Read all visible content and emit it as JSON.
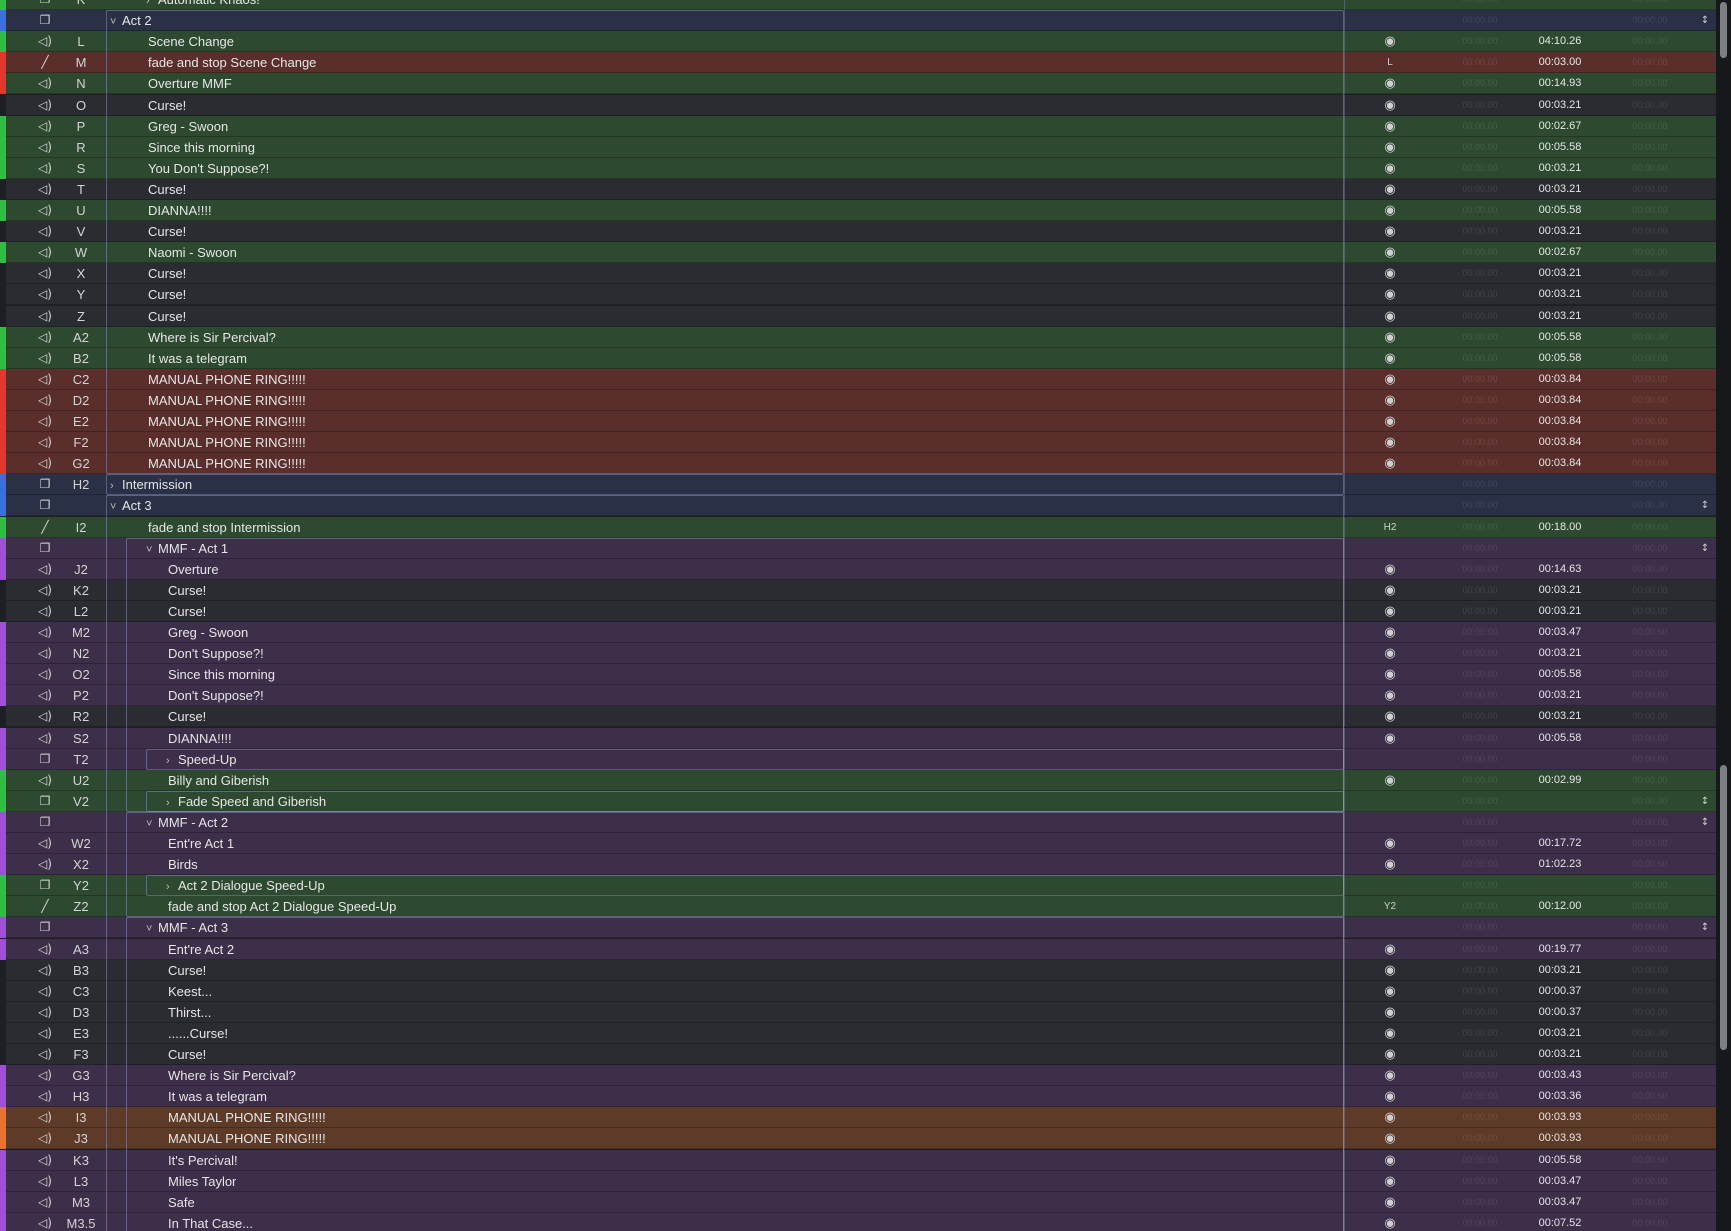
{
  "colors": {
    "dark": "#2b2c31",
    "green": "#2d4a30",
    "red": "#5a2f2b",
    "purple": "#3d2e4a",
    "orange": "#5e3a28",
    "navy": "#2a3046",
    "navy_green": "#2f3e3a",
    "bar_green": "#2fbf45",
    "bar_red": "#e0382c",
    "bar_purple": "#a04fd8",
    "bar_blue": "#3a6fe0",
    "bar_orange": "#e8732a",
    "bar_none": "#1e1f24"
  },
  "icons": {
    "audio": "speaker-icon",
    "group": "group-icon",
    "fade": "fade-icon",
    "target": "target-icon",
    "expanded": "chevron-down-icon",
    "collapsed": "chevron-right-icon",
    "continue": "auto-continue-icon"
  },
  "cues": [
    {
      "type": "group",
      "num": "K",
      "name": "Automatic Knaos!",
      "level": 1,
      "chev": "collapsed",
      "bg": "green",
      "bar": "green",
      "target": "",
      "duration": "",
      "cont": ""
    },
    {
      "type": "group",
      "num": "",
      "name": "Act 2",
      "level": 0,
      "chev": "expanded",
      "bg": "navy",
      "bar": "blue",
      "target": "",
      "duration": "",
      "cont": "continue"
    },
    {
      "type": "audio",
      "num": "L",
      "name": "Scene Change",
      "level": 1,
      "bg": "green",
      "bar": "green",
      "target": "icon",
      "duration": "04:10.26",
      "cont": ""
    },
    {
      "type": "fade",
      "num": "M",
      "name": "fade and stop Scene Change",
      "level": 1,
      "bg": "red",
      "bar": "red",
      "target": "L",
      "duration": "00:03.00",
      "cont": ""
    },
    {
      "type": "audio",
      "num": "N",
      "name": "Overture MMF",
      "level": 1,
      "bg": "green",
      "bar": "red",
      "target": "icon",
      "duration": "00:14.93",
      "cont": ""
    },
    {
      "type": "audio",
      "num": "O",
      "name": "Curse!",
      "level": 1,
      "bg": "dark",
      "bar": "none",
      "target": "icon",
      "duration": "00:03.21",
      "cont": ""
    },
    {
      "type": "audio",
      "num": "P",
      "name": "Greg - Swoon",
      "level": 1,
      "bg": "green",
      "bar": "green",
      "target": "icon",
      "duration": "00:02.67",
      "cont": ""
    },
    {
      "type": "audio",
      "num": "R",
      "name": "Since this morning",
      "level": 1,
      "bg": "green",
      "bar": "green",
      "target": "icon",
      "duration": "00:05.58",
      "cont": ""
    },
    {
      "type": "audio",
      "num": "S",
      "name": "You Don't Suppose?!",
      "level": 1,
      "bg": "green",
      "bar": "green",
      "target": "icon",
      "duration": "00:03.21",
      "cont": ""
    },
    {
      "type": "audio",
      "num": "T",
      "name": "Curse!",
      "level": 1,
      "bg": "dark",
      "bar": "none",
      "target": "icon",
      "duration": "00:03.21",
      "cont": ""
    },
    {
      "type": "audio",
      "num": "U",
      "name": "DIANNA!!!!",
      "level": 1,
      "bg": "green",
      "bar": "green",
      "target": "icon",
      "duration": "00:05.58",
      "cont": ""
    },
    {
      "type": "audio",
      "num": "V",
      "name": "Curse!",
      "level": 1,
      "bg": "dark",
      "bar": "none",
      "target": "icon",
      "duration": "00:03.21",
      "cont": ""
    },
    {
      "type": "audio",
      "num": "W",
      "name": "Naomi - Swoon",
      "level": 1,
      "bg": "green",
      "bar": "green",
      "target": "icon",
      "duration": "00:02.67",
      "cont": ""
    },
    {
      "type": "audio",
      "num": "X",
      "name": "Curse!",
      "level": 1,
      "bg": "dark",
      "bar": "none",
      "target": "icon",
      "duration": "00:03.21",
      "cont": ""
    },
    {
      "type": "audio",
      "num": "Y",
      "name": "Curse!",
      "level": 1,
      "bg": "dark",
      "bar": "none",
      "target": "icon",
      "duration": "00:03.21",
      "cont": ""
    },
    {
      "type": "audio",
      "num": "Z",
      "name": "Curse!",
      "level": 1,
      "bg": "dark",
      "bar": "none",
      "target": "icon",
      "duration": "00:03.21",
      "cont": ""
    },
    {
      "type": "audio",
      "num": "A2",
      "name": "Where is Sir Percival?",
      "level": 1,
      "bg": "green",
      "bar": "green",
      "target": "icon",
      "duration": "00:05.58",
      "cont": ""
    },
    {
      "type": "audio",
      "num": "B2",
      "name": "It was a telegram",
      "level": 1,
      "bg": "green",
      "bar": "green",
      "target": "icon",
      "duration": "00:05.58",
      "cont": ""
    },
    {
      "type": "audio",
      "num": "C2",
      "name": "MANUAL PHONE RING!!!!!",
      "level": 1,
      "bg": "red",
      "bar": "red",
      "target": "icon",
      "duration": "00:03.84",
      "cont": ""
    },
    {
      "type": "audio",
      "num": "D2",
      "name": "MANUAL PHONE RING!!!!!",
      "level": 1,
      "bg": "red",
      "bar": "red",
      "target": "icon",
      "duration": "00:03.84",
      "cont": ""
    },
    {
      "type": "audio",
      "num": "E2",
      "name": "MANUAL PHONE RING!!!!!",
      "level": 1,
      "bg": "red",
      "bar": "red",
      "target": "icon",
      "duration": "00:03.84",
      "cont": ""
    },
    {
      "type": "audio",
      "num": "F2",
      "name": "MANUAL PHONE RING!!!!!",
      "level": 1,
      "bg": "red",
      "bar": "red",
      "target": "icon",
      "duration": "00:03.84",
      "cont": ""
    },
    {
      "type": "audio",
      "num": "G2",
      "name": "MANUAL PHONE RING!!!!!",
      "level": 1,
      "bg": "red",
      "bar": "red",
      "target": "icon",
      "duration": "00:03.84",
      "cont": ""
    },
    {
      "type": "group",
      "num": "H2",
      "name": "Intermission",
      "level": 0,
      "chev": "collapsed",
      "bg": "navy",
      "bar": "blue",
      "target": "",
      "duration": "",
      "cont": ""
    },
    {
      "type": "group",
      "num": "",
      "name": "Act 3",
      "level": 0,
      "chev": "expanded",
      "bg": "navy",
      "bar": "blue",
      "target": "",
      "duration": "",
      "cont": "continue"
    },
    {
      "type": "fade",
      "num": "I2",
      "name": "fade and stop Intermission",
      "level": 1,
      "bg": "green",
      "bar": "green",
      "target": "H2",
      "duration": "00:18.00",
      "cont": ""
    },
    {
      "type": "group",
      "num": "",
      "name": "MMF - Act 1",
      "level": 1,
      "chev": "expanded",
      "bg": "purple",
      "bar": "purple",
      "target": "",
      "duration": "",
      "cont": "continue"
    },
    {
      "type": "audio",
      "num": "J2",
      "name": "Overture",
      "level": 2,
      "bg": "purple",
      "bar": "purple",
      "target": "icon",
      "duration": "00:14.63",
      "cont": ""
    },
    {
      "type": "audio",
      "num": "K2",
      "name": "Curse!",
      "level": 2,
      "bg": "dark",
      "bar": "none",
      "target": "icon",
      "duration": "00:03.21",
      "cont": ""
    },
    {
      "type": "audio",
      "num": "L2",
      "name": "Curse!",
      "level": 2,
      "bg": "dark",
      "bar": "none",
      "target": "icon",
      "duration": "00:03.21",
      "cont": ""
    },
    {
      "type": "audio",
      "num": "M2",
      "name": "Greg - Swoon",
      "level": 2,
      "bg": "purple",
      "bar": "purple",
      "target": "icon",
      "duration": "00:03.47",
      "cont": ""
    },
    {
      "type": "audio",
      "num": "N2",
      "name": "Don't Suppose?!",
      "level": 2,
      "bg": "purple",
      "bar": "purple",
      "target": "icon",
      "duration": "00:03.21",
      "cont": ""
    },
    {
      "type": "audio",
      "num": "O2",
      "name": "Since this morning",
      "level": 2,
      "bg": "purple",
      "bar": "purple",
      "target": "icon",
      "duration": "00:05.58",
      "cont": ""
    },
    {
      "type": "audio",
      "num": "P2",
      "name": "Don't Suppose?!",
      "level": 2,
      "bg": "purple",
      "bar": "purple",
      "target": "icon",
      "duration": "00:03.21",
      "cont": ""
    },
    {
      "type": "audio",
      "num": "R2",
      "name": "Curse!",
      "level": 2,
      "bg": "dark",
      "bar": "none",
      "target": "icon",
      "duration": "00:03.21",
      "cont": ""
    },
    {
      "type": "audio",
      "num": "S2",
      "name": "DIANNA!!!!",
      "level": 2,
      "bg": "purple",
      "bar": "purple",
      "target": "icon",
      "duration": "00:05.58",
      "cont": ""
    },
    {
      "type": "group",
      "num": "T2",
      "name": "Speed-Up",
      "level": 2,
      "chev": "collapsed",
      "bg": "purple",
      "bar": "purple",
      "target": "",
      "duration": "",
      "cont": ""
    },
    {
      "type": "audio",
      "num": "U2",
      "name": "Billy and Giberish",
      "level": 2,
      "bg": "green",
      "bar": "green",
      "target": "icon",
      "duration": "00:02.99",
      "cont": ""
    },
    {
      "type": "group",
      "num": "V2",
      "name": "Fade Speed and Giberish",
      "level": 2,
      "chev": "collapsed",
      "bg": "green",
      "bar": "green",
      "target": "",
      "duration": "",
      "cont": "continue"
    },
    {
      "type": "group",
      "num": "",
      "name": "MMF - Act 2",
      "level": 1,
      "chev": "expanded",
      "bg": "purple",
      "bar": "purple",
      "target": "",
      "duration": "",
      "cont": "continue"
    },
    {
      "type": "audio",
      "num": "W2",
      "name": "Ent're Act 1",
      "level": 2,
      "bg": "purple",
      "bar": "purple",
      "target": "icon",
      "duration": "00:17.72",
      "cont": ""
    },
    {
      "type": "audio",
      "num": "X2",
      "name": "Birds",
      "level": 2,
      "bg": "purple",
      "bar": "purple",
      "target": "icon",
      "duration": "01:02.23",
      "cont": ""
    },
    {
      "type": "group",
      "num": "Y2",
      "name": "Act 2 Dialogue Speed-Up",
      "level": 2,
      "chev": "collapsed",
      "bg": "green",
      "bar": "green",
      "target": "",
      "duration": "",
      "cont": ""
    },
    {
      "type": "fade",
      "num": "Z2",
      "name": "fade and stop Act 2 Dialogue Speed-Up",
      "level": 2,
      "bg": "green",
      "bar": "green",
      "target": "Y2",
      "duration": "00:12.00",
      "cont": ""
    },
    {
      "type": "group",
      "num": "",
      "name": "MMF - Act 3",
      "level": 1,
      "chev": "expanded",
      "bg": "purple",
      "bar": "purple",
      "target": "",
      "duration": "",
      "cont": "continue"
    },
    {
      "type": "audio",
      "num": "A3",
      "name": "Ent're Act 2",
      "level": 2,
      "bg": "purple",
      "bar": "purple",
      "target": "icon",
      "duration": "00:19.77",
      "cont": ""
    },
    {
      "type": "audio",
      "num": "B3",
      "name": "Curse!",
      "level": 2,
      "bg": "dark",
      "bar": "none",
      "target": "icon",
      "duration": "00:03.21",
      "cont": ""
    },
    {
      "type": "audio",
      "num": "C3",
      "name": "Keest...",
      "level": 2,
      "bg": "dark",
      "bar": "none",
      "target": "icon",
      "duration": "00:00.37",
      "cont": ""
    },
    {
      "type": "audio",
      "num": "D3",
      "name": "Thirst...",
      "level": 2,
      "bg": "dark",
      "bar": "none",
      "target": "icon",
      "duration": "00:00.37",
      "cont": ""
    },
    {
      "type": "audio",
      "num": "E3",
      "name": "......Curse!",
      "level": 2,
      "bg": "dark",
      "bar": "none",
      "target": "icon",
      "duration": "00:03.21",
      "cont": ""
    },
    {
      "type": "audio",
      "num": "F3",
      "name": "Curse!",
      "level": 2,
      "bg": "dark",
      "bar": "none",
      "target": "icon",
      "duration": "00:03.21",
      "cont": ""
    },
    {
      "type": "audio",
      "num": "G3",
      "name": "Where is Sir Percival?",
      "level": 2,
      "bg": "purple",
      "bar": "purple",
      "target": "icon",
      "duration": "00:03.43",
      "cont": ""
    },
    {
      "type": "audio",
      "num": "H3",
      "name": "It was a telegram",
      "level": 2,
      "bg": "purple",
      "bar": "purple",
      "target": "icon",
      "duration": "00:03.36",
      "cont": ""
    },
    {
      "type": "audio",
      "num": "I3",
      "name": "MANUAL PHONE RING!!!!!",
      "level": 2,
      "bg": "orange",
      "bar": "orange",
      "target": "icon",
      "duration": "00:03.93",
      "cont": ""
    },
    {
      "type": "audio",
      "num": "J3",
      "name": "MANUAL PHONE RING!!!!!",
      "level": 2,
      "bg": "orange",
      "bar": "orange",
      "target": "icon",
      "duration": "00:03.93",
      "cont": ""
    },
    {
      "type": "audio",
      "num": "K3",
      "name": "It's Percival!",
      "level": 2,
      "bg": "purple",
      "bar": "purple",
      "target": "icon",
      "duration": "00:05.58",
      "cont": ""
    },
    {
      "type": "audio",
      "num": "L3",
      "name": "Miles Taylor",
      "level": 2,
      "bg": "purple",
      "bar": "purple",
      "target": "icon",
      "duration": "00:03.47",
      "cont": ""
    },
    {
      "type": "audio",
      "num": "M3",
      "name": "Safe",
      "level": 2,
      "bg": "purple",
      "bar": "purple",
      "target": "icon",
      "duration": "00:03.47",
      "cont": ""
    },
    {
      "type": "audio",
      "num": "M3.5",
      "name": "In That Case...",
      "level": 2,
      "bg": "purple",
      "bar": "purple",
      "target": "icon",
      "duration": "00:07.52",
      "cont": ""
    }
  ],
  "blurred_cells": {
    "pre_wait": "00:00.00",
    "post_wait": "00:00.00"
  },
  "scroll_position": 0.37
}
